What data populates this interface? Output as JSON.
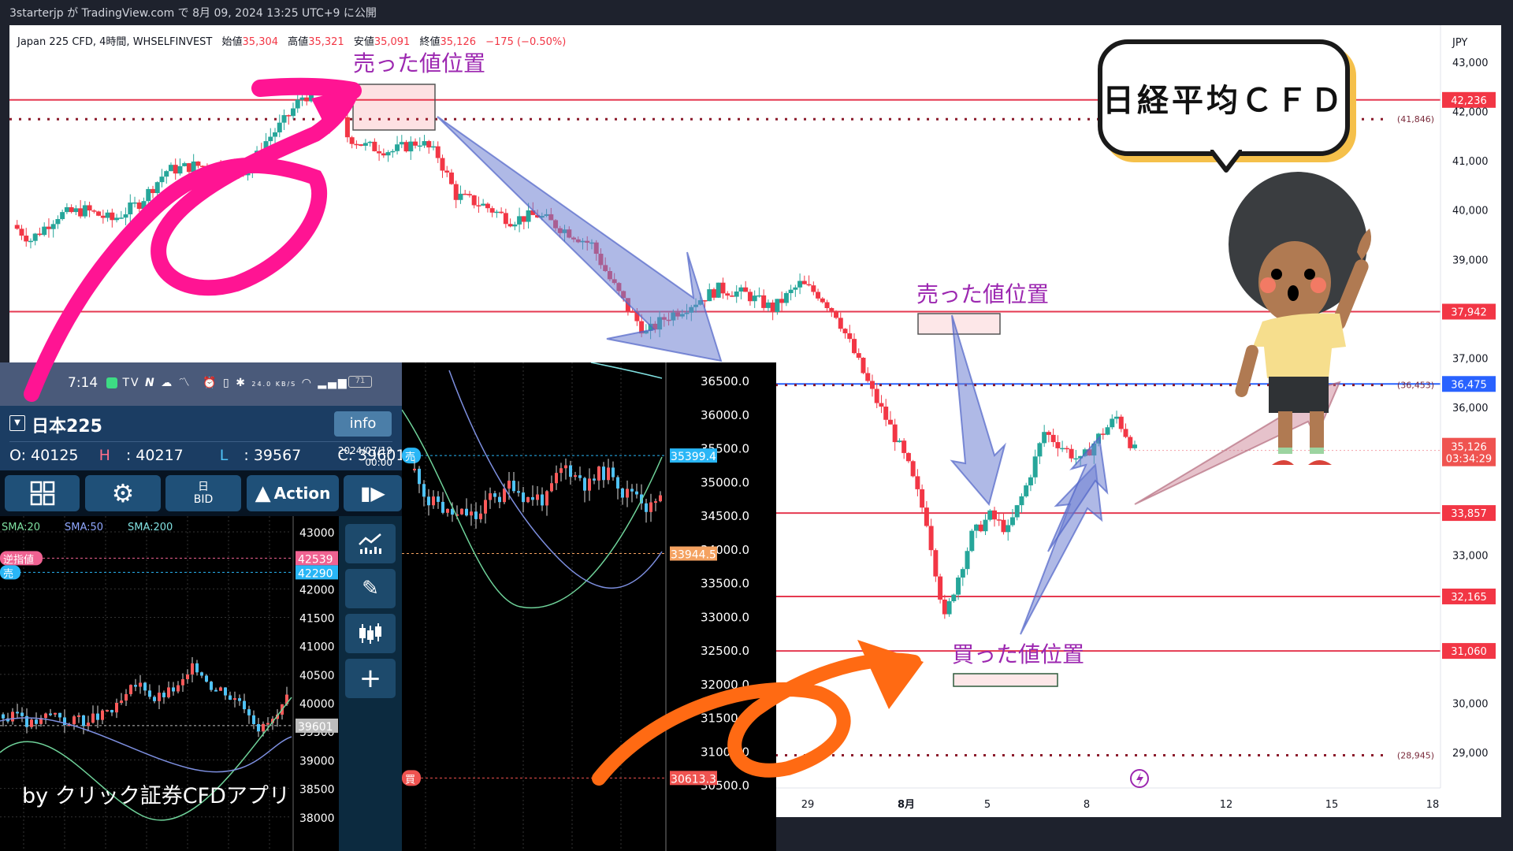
{
  "header": {
    "published_line": "3starterjp が TradingView.com で 8月 09, 2024 13:25 UTC+9 に公開"
  },
  "tradingview": {
    "symbol_line": "Japan 225 CFD, 4時間, WHSELFINVEST",
    "ohlc": [
      {
        "label": "始値",
        "value": "35,304"
      },
      {
        "label": "高値",
        "value": "35,321"
      },
      {
        "label": "安値",
        "value": "35,091"
      },
      {
        "label": "終値",
        "value": "35,126"
      }
    ],
    "change": "−175 (−0.50%)",
    "currency": "JPY",
    "annotations": {
      "sell_top": "売った値位置",
      "sell_mid": "売った値位置",
      "buy_bottom": "買った値位置"
    },
    "speech_bubble": "日経平均ＣＦＤ",
    "colors": {
      "up": "#26a69a",
      "down": "#f23645",
      "hline": "#e53950",
      "annot": "#9c27b0",
      "arrow_blue": "#7b8fd6",
      "arrow_pink": "#ff1493",
      "arrow_orange": "#ff6a13"
    }
  },
  "chart_data": [
    {
      "type": "line",
      "title": "Japan 225 CFD, 4時間, WHSELFINVEST",
      "xlabel": "",
      "ylabel": "JPY",
      "ylim": [
        28600,
        43300
      ],
      "y_ticks": [
        "43,000",
        "42,000",
        "41,000",
        "40,000",
        "39,000",
        "37,000",
        "36,000",
        "33,000",
        "30,000",
        "29,000"
      ],
      "x_ticks": [
        "29",
        "8月",
        "5",
        "8",
        "12",
        "15",
        "18"
      ],
      "grid": false,
      "price_path": [
        {
          "t": 0,
          "close": 39700
        },
        {
          "t": 2,
          "close": 39400
        },
        {
          "t": 5,
          "close": 39900
        },
        {
          "t": 8,
          "close": 40000
        },
        {
          "t": 11,
          "close": 39800
        },
        {
          "t": 14,
          "close": 40150
        },
        {
          "t": 17,
          "close": 40800
        },
        {
          "t": 20,
          "close": 40900
        },
        {
          "t": 23,
          "close": 40900
        },
        {
          "t": 26,
          "close": 40800
        },
        {
          "t": 28,
          "close": 41400
        },
        {
          "t": 30,
          "close": 41800
        },
        {
          "t": 32,
          "close": 42300
        },
        {
          "t": 34,
          "close": 42400
        },
        {
          "t": 36,
          "close": 42100
        },
        {
          "t": 37,
          "close": 41500
        },
        {
          "t": 39,
          "close": 41300
        },
        {
          "t": 42,
          "close": 41200
        },
        {
          "t": 45,
          "close": 41400
        },
        {
          "t": 47,
          "close": 41100
        },
        {
          "t": 49,
          "close": 40300
        },
        {
          "t": 52,
          "close": 40100
        },
        {
          "t": 55,
          "close": 39800
        },
        {
          "t": 58,
          "close": 39900
        },
        {
          "t": 61,
          "close": 39600
        },
        {
          "t": 64,
          "close": 39300
        },
        {
          "t": 66,
          "close": 38600
        },
        {
          "t": 68,
          "close": 38000
        },
        {
          "t": 70,
          "close": 37500
        },
        {
          "t": 72,
          "close": 37800
        },
        {
          "t": 75,
          "close": 38100
        },
        {
          "t": 78,
          "close": 38400
        },
        {
          "t": 81,
          "close": 38300
        },
        {
          "t": 84,
          "close": 38000
        },
        {
          "t": 87,
          "close": 38500
        },
        {
          "t": 89,
          "close": 38300
        },
        {
          "t": 91,
          "close": 37900
        },
        {
          "t": 93,
          "close": 37100
        },
        {
          "t": 95,
          "close": 36300
        },
        {
          "t": 97,
          "close": 35600
        },
        {
          "t": 99,
          "close": 34800
        },
        {
          "t": 101,
          "close": 33700
        },
        {
          "t": 103,
          "close": 31700
        },
        {
          "t": 104,
          "close": 32300
        },
        {
          "t": 106,
          "close": 33400
        },
        {
          "t": 108,
          "close": 33800
        },
        {
          "t": 110,
          "close": 33500
        },
        {
          "t": 112,
          "close": 34400
        },
        {
          "t": 114,
          "close": 35500
        },
        {
          "t": 116,
          "close": 35200
        },
        {
          "t": 118,
          "close": 34900
        },
        {
          "t": 120,
          "close": 35400
        },
        {
          "t": 122,
          "close": 35800
        },
        {
          "t": 124,
          "close": 35126
        }
      ],
      "horizontal_lines": [
        {
          "value": 42236,
          "label": "42,236",
          "style": "solid"
        },
        {
          "value": 41846,
          "label": "(41,846)",
          "style": "dotted"
        },
        {
          "value": 37942,
          "label": "37,942",
          "style": "solid"
        },
        {
          "value": 36475,
          "label": "36,475",
          "style": "solid-blue"
        },
        {
          "value": 36453,
          "label": "(36,453)",
          "style": "dotted"
        },
        {
          "value": 35126,
          "label": "35,126",
          "sub": "03:34:29",
          "style": "dotted-last"
        },
        {
          "value": 33857,
          "label": "33,857",
          "style": "solid"
        },
        {
          "value": 32165,
          "label": "32,165",
          "style": "solid"
        },
        {
          "value": 31060,
          "label": "31,060",
          "style": "solid"
        },
        {
          "value": 28945,
          "label": "(28,945)",
          "style": "dotted"
        }
      ]
    },
    {
      "type": "line",
      "title": "日本225 (クリック証券CFDアプリ)",
      "ylim": [
        37950,
        43150
      ],
      "y_ticks": [
        "43000",
        "42000",
        "41500",
        "41000",
        "40500",
        "40000",
        "39500",
        "39000",
        "38500",
        "38000"
      ],
      "legend": [
        "SMA:20",
        "SMA:50",
        "SMA:200"
      ],
      "price_tags": [
        {
          "label": "逆指値",
          "value": "42539",
          "color": "#f06292"
        },
        {
          "label": "売",
          "value": "42290",
          "color": "#29b6f6"
        },
        {
          "label": "",
          "value": "39601",
          "color": "#bdbdbd"
        }
      ]
    },
    {
      "type": "line",
      "title": "日本225 intraday (middle dark panel)",
      "ylim": [
        30400,
        36650
      ],
      "y_ticks": [
        "36500.0",
        "36000.0",
        "35500.0",
        "35000.0",
        "34500.0",
        "34000.0",
        "33500.0",
        "33000.0",
        "32500.0",
        "32000.0",
        "31500.0",
        "31000.0",
        "30500.0"
      ],
      "price_tags": [
        {
          "label": "売",
          "value": "35399.4",
          "color": "#29b6f6"
        },
        {
          "label": "",
          "value": "33944.5",
          "color": "#f4a261"
        },
        {
          "label": "買",
          "value": "30613.3",
          "color": "#ef5350"
        }
      ]
    }
  ],
  "phone": {
    "status": {
      "time": "7:14",
      "net_speed": "24.0 KB/S",
      "battery": "71"
    },
    "symbol": "日本225",
    "info_button": "info",
    "ohlc": {
      "o": "O: 40125",
      "h_label": "H",
      "h": ": 40217",
      "l_label": "L",
      "l": ": 39567",
      "c": "C: 39601"
    },
    "date": "2024/07/19",
    "time": "00:00",
    "buttons": {
      "grid": "grid-menu",
      "settings": "settings",
      "period_top": "日",
      "period_bottom": "BID",
      "action": "Action",
      "play": "play"
    },
    "watermark": "by クリック証券CFDアプリ"
  }
}
